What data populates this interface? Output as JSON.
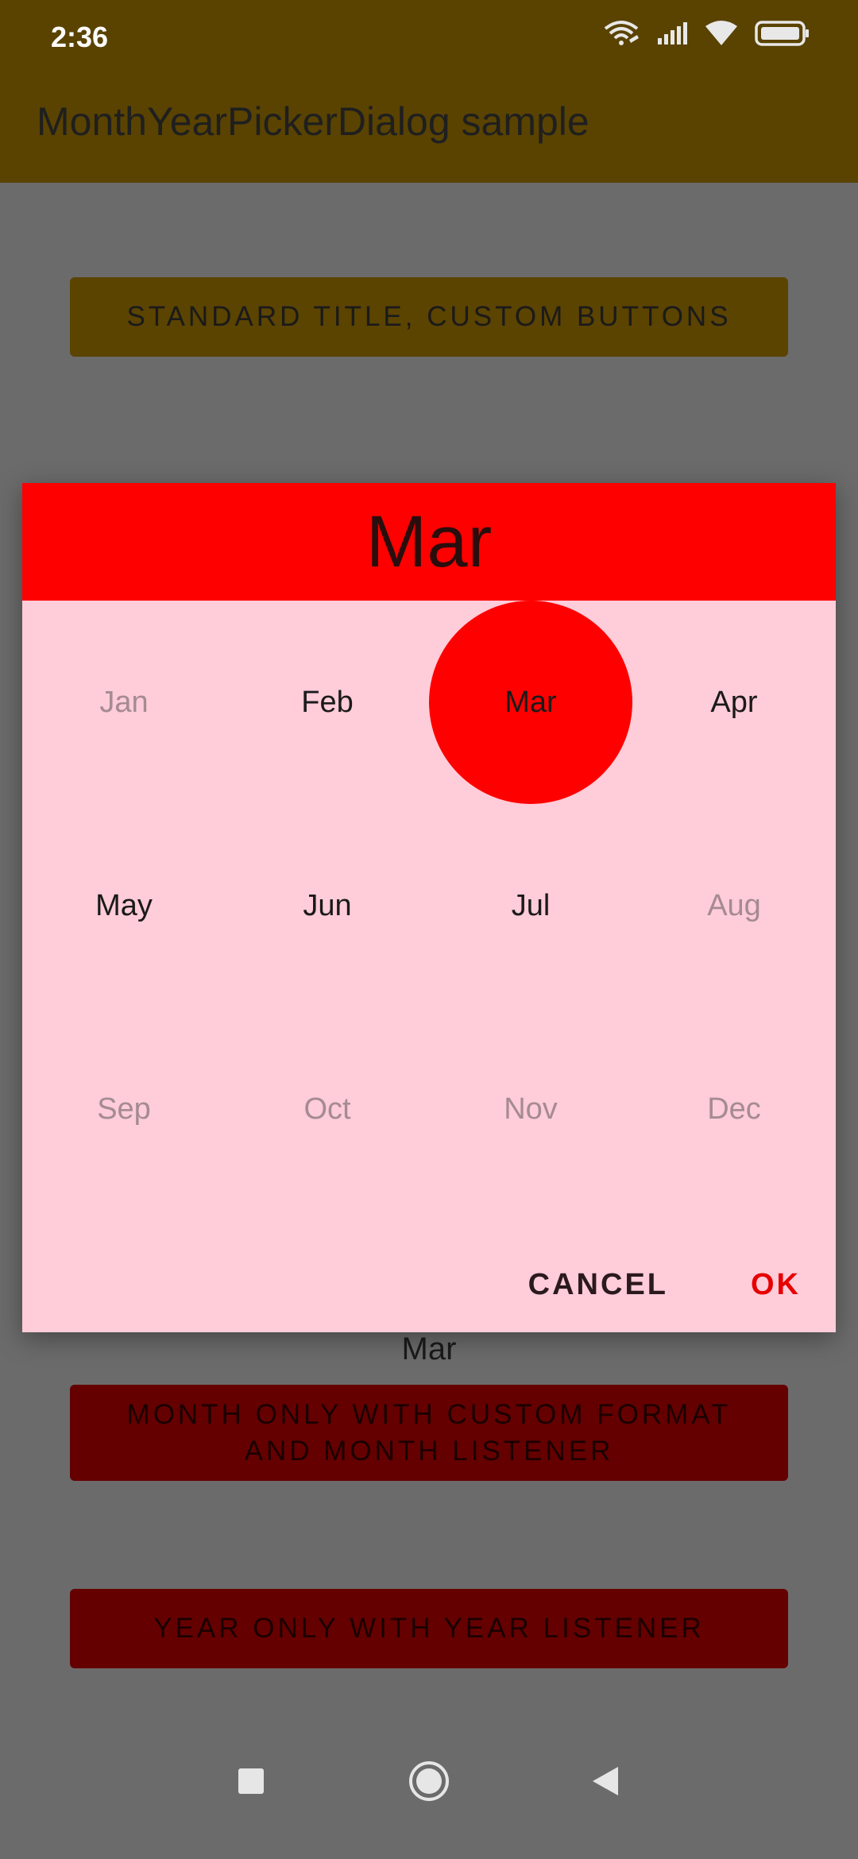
{
  "status_bar": {
    "time": "2:36",
    "icons": [
      "wifi-calling-icon",
      "signal-icon",
      "wifi-icon",
      "battery-icon"
    ]
  },
  "app_bar": {
    "title": "MonthYearPickerDialog sample",
    "color": "#5a4300"
  },
  "buttons": {
    "standard": "STANDARD TITLE, CUSTOM BUTTONS",
    "month_only": "MONTH ONLY WITH CUSTOM FORMAT AND MONTH LISTENER",
    "year_only": "YEAR ONLY WITH YEAR LISTENER"
  },
  "result_text": "Mar",
  "dialog": {
    "title": "Mar",
    "selected_month": "Mar",
    "months": [
      {
        "label": "Jan",
        "enabled": false
      },
      {
        "label": "Feb",
        "enabled": true
      },
      {
        "label": "Mar",
        "enabled": true,
        "selected": true
      },
      {
        "label": "Apr",
        "enabled": true
      },
      {
        "label": "May",
        "enabled": true
      },
      {
        "label": "Jun",
        "enabled": true
      },
      {
        "label": "Jul",
        "enabled": true
      },
      {
        "label": "Aug",
        "enabled": false
      },
      {
        "label": "Sep",
        "enabled": false
      },
      {
        "label": "Oct",
        "enabled": false
      },
      {
        "label": "Nov",
        "enabled": false
      },
      {
        "label": "Dec",
        "enabled": false
      }
    ],
    "cancel_label": "CANCEL",
    "ok_label": "OK",
    "header_color": "#ff0000",
    "body_color": "#ffccd9"
  },
  "nav_bar": {
    "icons": [
      "recents-square-icon",
      "home-circle-icon",
      "back-triangle-icon"
    ]
  }
}
